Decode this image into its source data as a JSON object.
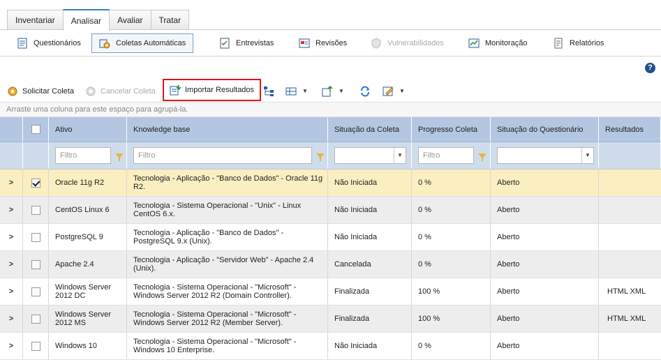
{
  "top_tabs": [
    "Inventariar",
    "Analisar",
    "Avaliar",
    "Tratar"
  ],
  "subnav": {
    "items": [
      {
        "label": "Questionários",
        "icon": "questionnaire-icon"
      },
      {
        "label": "Coletas Automáticas",
        "icon": "automatic-collection-icon"
      },
      {
        "label": "Entrevistas",
        "icon": "interview-icon"
      },
      {
        "label": "Revisões",
        "icon": "review-icon"
      },
      {
        "label": "Vulnerabilidades",
        "icon": "vulnerability-icon"
      },
      {
        "label": "Monitoração",
        "icon": "monitoring-icon"
      },
      {
        "label": "Relatórios",
        "icon": "report-icon"
      }
    ]
  },
  "help": "?",
  "toolbar": {
    "request": "Solicitar Coleta",
    "cancel": "Cancelar Coleta",
    "import": "Importar Resultados"
  },
  "group_hint": "Arraste uma coluna para este espaço para agrupá-la.",
  "grid": {
    "columns": [
      "Ativo",
      "Knowledge base",
      "Situação da Coleta",
      "Progresso Coleta",
      "Situação do Questionário",
      "Resultados"
    ],
    "filter_placeholder": "Filtro",
    "rows": [
      {
        "checked": true,
        "asset": "Oracle 11g R2",
        "kb": "Tecnologia - Aplicação - \"Banco de Dados\" - Oracle 11g R2.",
        "status": "Não Iniciada",
        "progress": "0 %",
        "q_status": "Aberto",
        "results": ""
      },
      {
        "checked": false,
        "asset": "CentOS Linux 6",
        "kb": "Tecnologia - Sistema Operacional - \"Unix\" - Linux CentOS 6.x.",
        "status": "Não Iniciada",
        "progress": "0 %",
        "q_status": "Aberto",
        "results": ""
      },
      {
        "checked": false,
        "asset": "PostgreSQL 9",
        "kb": "Tecnologia - Aplicação - \"Banco de Dados\" - PostgreSQL 9.x (Unix).",
        "status": "Não Iniciada",
        "progress": "0 %",
        "q_status": "Aberto",
        "results": ""
      },
      {
        "checked": false,
        "asset": "Apache 2.4",
        "kb": "Tecnologia - Aplicação - \"Servidor Web\" - Apache 2.4 (Unix).",
        "status": "Cancelada",
        "progress": "0 %",
        "q_status": "Aberto",
        "results": ""
      },
      {
        "checked": false,
        "asset": "Windows Server 2012 DC",
        "kb": "Tecnologia - Sistema Operacional - \"Microsoft\" - Windows Server 2012 R2 (Domain Controller).",
        "status": "Finalizada",
        "progress": "100 %",
        "q_status": "Aberto",
        "results": "HTML XML"
      },
      {
        "checked": false,
        "asset": "Windows Server 2012 MS",
        "kb": "Tecnologia - Sistema Operacional - \"Microsoft\" - Windows Server 2012 R2 (Member Server).",
        "status": "Finalizada",
        "progress": "100 %",
        "q_status": "Aberto",
        "results": "HTML XML"
      },
      {
        "checked": false,
        "asset": "Windows 10",
        "kb": "Tecnologia - Sistema Operacional - \"Microsoft\" - Windows 10 Enterprise.",
        "status": "Não Iniciada",
        "progress": "0 %",
        "q_status": "Aberto",
        "results": ""
      }
    ]
  },
  "colors": {
    "header": "#b3c7e2",
    "filter_row": "#cfdcec",
    "selected_row": "#fbeec0",
    "highlight_border": "#e0141e"
  }
}
